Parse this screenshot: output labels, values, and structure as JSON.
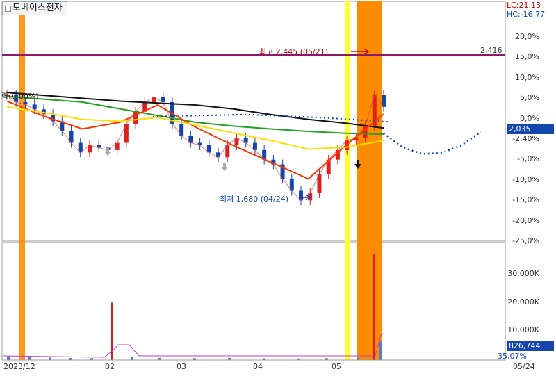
{
  "header": {
    "stock_name": "모베이스전자",
    "lc_text": "LC:21,13",
    "hc_text": "HC:-16,77"
  },
  "price_axis": {
    "ticks": [
      "20,0%",
      "15,0%",
      "10,0%",
      "5,0%",
      "0,0%",
      "-2,40%",
      "-5,0%",
      "-10,0%",
      "-15,0%",
      "-20,0%",
      "-25,0%"
    ],
    "hline_label": "2,416",
    "current_badge": "2,035"
  },
  "volume_axis": {
    "ticks": [
      "30,000K",
      "20,000K",
      "10,000K"
    ],
    "current_badge": "826,744",
    "pct_label": "35,07%"
  },
  "x_axis": {
    "labels": [
      "2023/12",
      "02",
      "03",
      "04",
      "05",
      "05/24"
    ]
  },
  "annotations": {
    "high": "최고 2,445 (05/21)",
    "low": "최저 1,680 (04/24)",
    "left_note": "락(0,00%)"
  },
  "colors": {
    "up": "#e02020",
    "down": "#1446b0",
    "highlight_orange": "#ff8c00",
    "highlight_yellow": "#ffff33",
    "hline": "#8b1a6b"
  },
  "chart_data": {
    "type": "candlestick",
    "y_unit": "% change",
    "ylim": [
      -28,
      22
    ],
    "points": [
      [
        "2023/12",
        2.5
      ],
      [
        "",
        1.0
      ],
      [
        "",
        0.5
      ],
      [
        "",
        -0.5
      ],
      [
        "",
        -1.5
      ],
      [
        "",
        -3.0
      ],
      [
        "",
        -5.0
      ],
      [
        "",
        -7.5
      ],
      [
        "",
        -9.5
      ],
      [
        "",
        -8.0
      ],
      [
        "",
        -8.5
      ],
      [
        "",
        -9.0
      ],
      [
        "02",
        -7.5
      ],
      [
        "",
        -3.5
      ],
      [
        "",
        -1.0
      ],
      [
        "",
        1.0
      ],
      [
        "",
        2.0
      ],
      [
        "",
        1.0
      ],
      [
        "",
        -3.5
      ],
      [
        "",
        -6.0
      ],
      [
        "",
        -7.5
      ],
      [
        "",
        -8.0
      ],
      [
        "03",
        -9.5
      ],
      [
        "",
        -10.5
      ],
      [
        "",
        -8.0
      ],
      [
        "",
        -6.5
      ],
      [
        "",
        -7.5
      ],
      [
        "",
        -9.0
      ],
      [
        "",
        -11.0
      ],
      [
        "04",
        -12.0
      ],
      [
        "",
        -15.0
      ],
      [
        "",
        -17.5
      ],
      [
        "",
        -19.5
      ],
      [
        "",
        -18.0
      ],
      [
        "",
        -14.0
      ],
      [
        "",
        -11.0
      ],
      [
        "05",
        -9.0
      ],
      [
        "",
        -7.0
      ],
      [
        "",
        -6.5
      ],
      [
        "",
        -4.0
      ],
      [
        "",
        2.5
      ],
      [
        "05/24",
        0.0
      ]
    ],
    "moving_averages": [
      {
        "color": "#111111",
        "values": [
          3.0,
          2.4,
          1.8,
          1.2,
          0.8,
          0.4,
          -0.4,
          -1.6,
          -2.6,
          -3.4,
          -4.4
        ]
      },
      {
        "color": "#22a022",
        "values": [
          2.2,
          1.6,
          1.0,
          -0.4,
          -1.8,
          -3.2,
          -4.0,
          -4.6,
          -5.1,
          -5.5,
          -5.7
        ]
      },
      {
        "color": "#ff3300",
        "values": [
          1.2,
          -2.0,
          -4.6,
          -3.2,
          0.4,
          -4.2,
          -8.0,
          -11.5,
          -15.0,
          -8.0,
          -1.5
        ]
      },
      {
        "color": "#ffdd00",
        "values": [
          0.0,
          -1.2,
          -2.6,
          -3.0,
          -2.2,
          -3.8,
          -5.4,
          -7.0,
          -8.8,
          -8.4,
          -7.0
        ]
      }
    ],
    "forecast": [
      -5.5,
      -8.5,
      -9.8,
      -9.6,
      -8.0,
      -5.2
    ],
    "volume": [
      1200,
      900,
      800,
      700,
      600,
      18500,
      900,
      700,
      600,
      700,
      600,
      500,
      600,
      800,
      34000,
      6000
    ],
    "volume_ylim": [
      0,
      36000
    ]
  }
}
